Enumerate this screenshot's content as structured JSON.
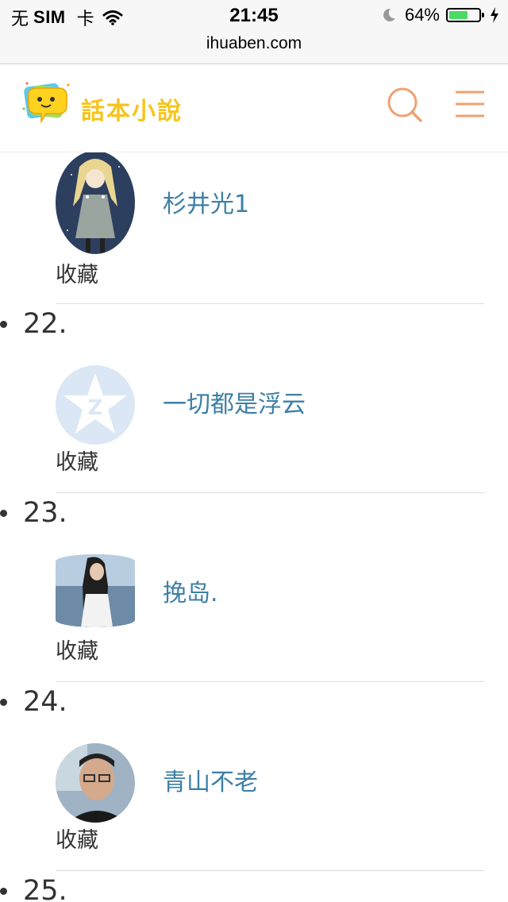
{
  "status_bar": {
    "carrier": "无",
    "sim": "SIM",
    "sim_suffix": "卡",
    "time": "21:45",
    "battery_percent": "64%",
    "battery_level": 0.64,
    "icons": [
      "wifi-icon",
      "moon-icon",
      "battery-icon",
      "charging-icon"
    ]
  },
  "browser": {
    "url": "ihuaben.com"
  },
  "header": {
    "logo_text": "話本小說",
    "icons": [
      "search-icon",
      "menu-icon"
    ],
    "accent_color": "#f0a070"
  },
  "entries": [
    {
      "number": "",
      "name": "杉井光1",
      "collect_label": "收藏",
      "avatar": "anime-girl-avatar"
    },
    {
      "number": "22.",
      "name": "一切都是浮云",
      "collect_label": "收藏",
      "avatar": "qq-default-avatar"
    },
    {
      "number": "23.",
      "name": "挽岛.",
      "collect_label": "收藏",
      "avatar": "girl-photo-avatar"
    },
    {
      "number": "24.",
      "name": "青山不老",
      "collect_label": "收藏",
      "avatar": "man-photo-avatar"
    },
    {
      "number": "25.",
      "name": "",
      "collect_label": "",
      "avatar": ""
    }
  ],
  "colors": {
    "link": "#3d7fa6",
    "text": "#333333",
    "logo_yellow": "#f5c51b"
  }
}
